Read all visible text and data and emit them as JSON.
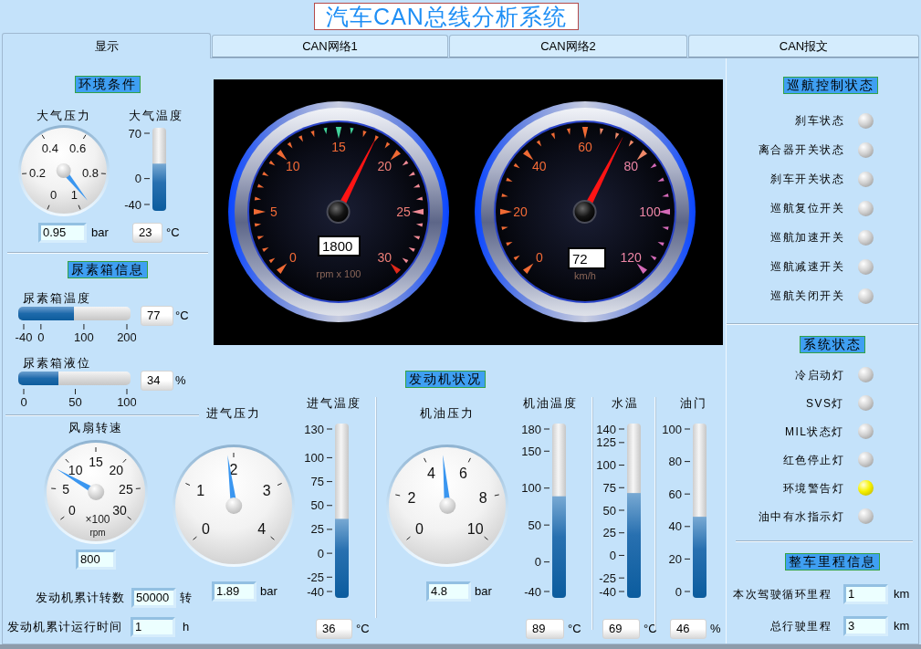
{
  "title": "汽车CAN总线分析系统",
  "tabs": [
    {
      "label": "显示",
      "selected": true
    },
    {
      "label": "CAN网络1",
      "selected": false
    },
    {
      "label": "CAN网络2",
      "selected": false
    },
    {
      "label": "CAN报文",
      "selected": false
    }
  ],
  "environment": {
    "heading": "环境条件",
    "pressure": {
      "label": "大气压力",
      "ticks": [
        "0",
        "0.2",
        "0.4",
        "0.6",
        "0.8",
        "1"
      ],
      "level": 0.95,
      "value": "0.95",
      "unit": "bar"
    },
    "temperature": {
      "label": "大气温度",
      "ticks": [
        "70",
        "0",
        "-40"
      ],
      "level": 0.573,
      "value": "23",
      "unit": "°C"
    }
  },
  "urea_tank": {
    "heading": "尿素箱信息",
    "bars": [
      {
        "label": "尿素箱温度",
        "ticks": [
          "-40",
          "0",
          "100",
          "200"
        ],
        "level": 0.488,
        "value": "77",
        "unit": "°C"
      },
      {
        "label": "尿素箱液位",
        "ticks": [
          "0",
          "50",
          "100"
        ],
        "level": 0.34,
        "value": "34",
        "unit": "%"
      }
    ]
  },
  "fan_speed": {
    "label": "风扇转速",
    "ticks": [
      "0",
      "5",
      "10",
      "15",
      "20",
      "25",
      "30"
    ],
    "multiplier": "×100",
    "unit": "rpm",
    "level": 0.267,
    "value": "800"
  },
  "engine_totals": [
    {
      "label": "发动机累计转数",
      "value": "50000",
      "unit": "转"
    },
    {
      "label": "发动机累计运行时间",
      "value": "1",
      "unit": "h"
    }
  ],
  "dashboard": {
    "tachometer": {
      "ticks": [
        "0",
        "5",
        "10",
        "15",
        "20",
        "25",
        "30"
      ],
      "unit": "rpm x 100",
      "level": 0.6,
      "value": "1800"
    },
    "speedometer": {
      "ticks": [
        "0",
        "20",
        "40",
        "60",
        "80",
        "100",
        "120"
      ],
      "unit": "km/h",
      "level": 0.6,
      "value": "72"
    }
  },
  "engine": {
    "heading": "发动机状况",
    "intake_pressure": {
      "label": "进气压力",
      "ticks": [
        "0",
        "1",
        "2",
        "3",
        "4"
      ],
      "level": 0.4725,
      "value": "1.89",
      "unit": "bar"
    },
    "intake_temperature": {
      "label": "进气温度",
      "ticks": [
        "130",
        "100",
        "75",
        "50",
        "25",
        "0",
        "-25",
        "-40"
      ],
      "level": 0.447,
      "value": "36",
      "unit": "°C"
    },
    "oil_pressure": {
      "label": "机油压力",
      "ticks": [
        "0",
        "2",
        "4",
        "6",
        "8",
        "10"
      ],
      "level": 0.48,
      "value": "4.8",
      "unit": "bar"
    },
    "oil_temperature": {
      "label": "机油温度",
      "ticks": [
        "180",
        "150",
        "100",
        "50",
        "0",
        "-40"
      ],
      "level": 0.586,
      "value": "89",
      "unit": "°C"
    },
    "water_temperature": {
      "label": "水温",
      "ticks": [
        "140",
        "125",
        "100",
        "75",
        "50",
        "25",
        "0",
        "-25",
        "-40"
      ],
      "level": 0.606,
      "value": "69",
      "unit": "°C"
    },
    "throttle": {
      "label": "油门",
      "ticks": [
        "100",
        "80",
        "60",
        "40",
        "20",
        "0"
      ],
      "level": 0.46,
      "value": "46",
      "unit": "%"
    }
  },
  "cruise_control": {
    "heading": "巡航控制状态",
    "lamps": [
      {
        "label": "刹车状态",
        "on": false
      },
      {
        "label": "离合器开关状态",
        "on": false
      },
      {
        "label": "刹车开关状态",
        "on": false
      },
      {
        "label": "巡航复位开关",
        "on": false
      },
      {
        "label": "巡航加速开关",
        "on": false
      },
      {
        "label": "巡航减速开关",
        "on": false
      },
      {
        "label": "巡航关闭开关",
        "on": false
      }
    ]
  },
  "system_status": {
    "heading": "系统状态",
    "lamps": [
      {
        "label": "冷启动灯",
        "on": false
      },
      {
        "label": "SVS灯",
        "on": false
      },
      {
        "label": "MIL状态灯",
        "on": false
      },
      {
        "label": "红色停止灯",
        "on": false
      },
      {
        "label": "环境警告灯",
        "on": true
      },
      {
        "label": "油中有水指示灯",
        "on": false
      }
    ]
  },
  "mileage": {
    "heading": "整车里程信息",
    "rows": [
      {
        "label": "本次驾驶循环里程",
        "value": "1",
        "unit": "km"
      },
      {
        "label": "总行驶里程",
        "value": "3",
        "unit": "km"
      }
    ]
  }
}
